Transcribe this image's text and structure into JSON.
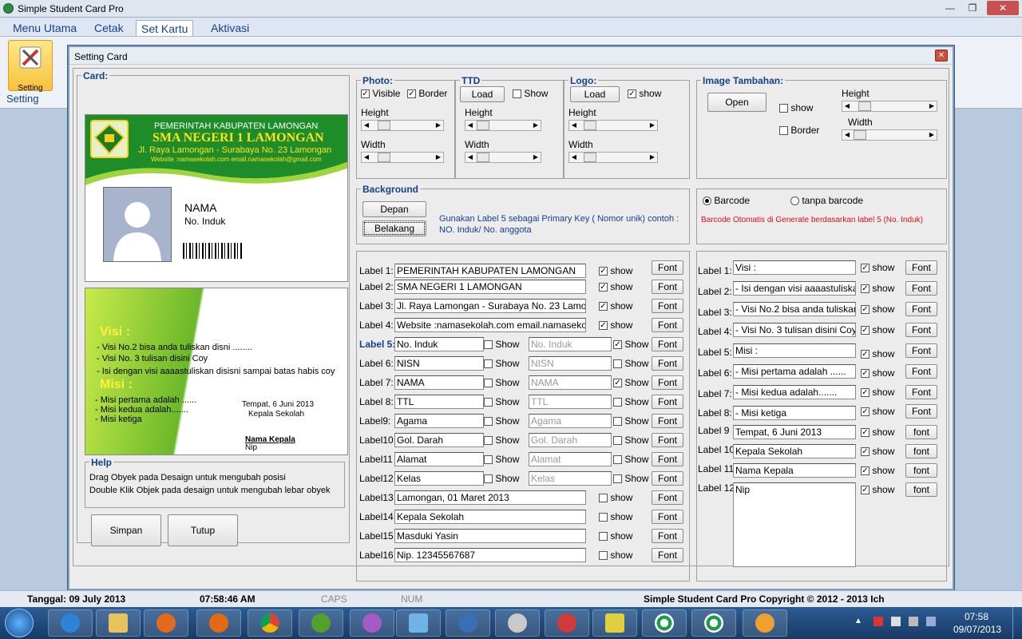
{
  "app_title": "Simple Student Card Pro",
  "menu": [
    "Menu Utama",
    "Cetak",
    "Set Kartu",
    "Aktivasi"
  ],
  "ribbon": {
    "button_label": "Setting",
    "group_label": "Setting"
  },
  "dialog": {
    "title": "Setting Card",
    "card_group": "Card:",
    "card_front": {
      "header_line1": "PEMERINTAH KABUPATEN LAMONGAN",
      "header_line2": "SMA NEGERI 1 LAMONGAN",
      "header_line3": "Jl. Raya Lamongan - Surabaya No. 23 Lamongan",
      "header_line4": "Website :namasekolah.com email.namasekolah@gmail.com",
      "name": "NAMA",
      "induk": "No. Induk"
    },
    "card_back": {
      "visi_title": "Visi :",
      "visi_items": [
        "- Visi No.2 bisa anda tuliskan disni ........",
        "- Visi No. 3 tulisan disini Coy",
        "- Isi dengan visi aaaastuliskan disisni sampai batas habis coy"
      ],
      "misi_title": "Misi :",
      "misi_items": [
        "- Misi pertama adalah ......",
        "- Misi kedua adalah.......",
        "- Misi ketiga"
      ],
      "place_date": "Tempat, 6 Juni 2013",
      "position": "Kepala Sekolah",
      "head_name": "Nama Kepala",
      "nip": "Nip"
    },
    "help": {
      "title": "Help",
      "line1": "Drag Obyek pada Desaign untuk mengubah posisi",
      "line2": "Double Klik Objek pada desaign untuk mengubah lebar obyek"
    },
    "buttons": {
      "save": "Simpan",
      "close": "Tutup"
    },
    "photo": {
      "title": "Photo:",
      "visible": "Visible",
      "border": "Border",
      "height": "Height",
      "width": "Width"
    },
    "ttd": {
      "title": "TTD",
      "load": "Load",
      "show": "Show",
      "height": "Height",
      "width": "Width"
    },
    "logo": {
      "title": "Logo:",
      "load": "Load",
      "show": "show",
      "height": "Height",
      "width": "Width"
    },
    "image_tambahan": {
      "title": "Image Tambahan:",
      "open": "Open",
      "show": "show",
      "border": "Border",
      "height": "Height",
      "width": "Width"
    },
    "background": {
      "title": "Background",
      "front": "Depan",
      "back": "Belakang",
      "hint_line1": "Gunakan Label 5 sebagai Primary Key ( Nomor unik) contoh :",
      "hint_line2": "NO. Induk/ No. anggota"
    },
    "barcode": {
      "opt1": "Barcode",
      "opt2": "tanpa barcode",
      "note": "Barcode Otomatis di Generate berdasarkan label 5 (No. Induk)"
    },
    "front_labels": [
      {
        "label": "Label 1:",
        "value": "PEMERINTAH KABUPATEN LAMONGAN",
        "show": "show",
        "checked": true,
        "font": "Font"
      },
      {
        "label": "Label 2:",
        "value": "SMA NEGERI 1 LAMONGAN",
        "show": "show",
        "checked": true,
        "font": "Font"
      },
      {
        "label": "Label 3:",
        "value": "Jl. Raya Lamongan - Surabaya No. 23 Lamongan",
        "show": "show",
        "checked": true,
        "font": "Font"
      },
      {
        "label": "Label 4:",
        "value": "Website :namasekolah.com email.namasekolah@",
        "show": "show",
        "checked": true,
        "font": "Font"
      }
    ],
    "front_pair_labels": [
      {
        "label": "Label 5:",
        "value": "No. Induk",
        "show1": "Show",
        "c1": false,
        "value2": "No. Induk",
        "show2": "Show",
        "c2": true,
        "font": "Font",
        "bold": true
      },
      {
        "label": "Label 6:",
        "value": "NISN",
        "show1": "Show",
        "c1": false,
        "value2": "NISN",
        "show2": "Show",
        "c2": false,
        "font": "Font"
      },
      {
        "label": "Label 7:",
        "value": "NAMA",
        "show1": "Show",
        "c1": false,
        "value2": "NAMA",
        "show2": "Show",
        "c2": true,
        "font": "Font"
      },
      {
        "label": "Label 8:",
        "value": "TTL",
        "show1": "Show",
        "c1": false,
        "value2": "TTL",
        "show2": "Show",
        "c2": false,
        "font": "Font"
      },
      {
        "label": "Label9:",
        "value": "Agama",
        "show1": "Show",
        "c1": false,
        "value2": "Agama",
        "show2": "Show",
        "c2": false,
        "font": "Font"
      },
      {
        "label": "Label10:",
        "value": "Gol. Darah",
        "show1": "Show",
        "c1": false,
        "value2": "Gol. Darah",
        "show2": "Show",
        "c2": false,
        "font": "Font"
      },
      {
        "label": "Label11",
        "value": "Alamat",
        "show1": "Show",
        "c1": false,
        "value2": "Alamat",
        "show2": "Show",
        "c2": false,
        "font": "Font"
      },
      {
        "label": "Label12",
        "value": "Kelas",
        "show1": "Show",
        "c1": false,
        "value2": "Kelas",
        "show2": "Show",
        "c2": false,
        "font": "Font"
      }
    ],
    "front_extra_labels": [
      {
        "label": "Label13",
        "value": "Lamongan, 01 Maret 2013",
        "show": "show",
        "checked": false,
        "font": "Font"
      },
      {
        "label": "Label14",
        "value": "Kepala Sekolah",
        "show": "show",
        "checked": false,
        "font": "Font"
      },
      {
        "label": "Label15",
        "value": "Masduki Yasin",
        "show": "show",
        "checked": false,
        "font": "Font"
      },
      {
        "label": "Label16",
        "value": "Nip. 12345567687",
        "show": "show",
        "checked": false,
        "font": "Font"
      }
    ],
    "back_labels": [
      {
        "label": "Label 1:",
        "value": "Visi :",
        "show": "show",
        "checked": true,
        "font": "Font"
      },
      {
        "label": "Label 2:",
        "value": "- Isi dengan visi aaaastuliskan",
        "show": "show",
        "checked": true,
        "font": "Font"
      },
      {
        "label": "Label 3:",
        "value": "- Visi No.2 bisa anda tuliskan",
        "show": "show",
        "checked": true,
        "font": "Font"
      },
      {
        "label": "Label 4:",
        "value": "- Visi No. 3 tulisan disini Coy",
        "show": "show",
        "checked": true,
        "font": "Font"
      },
      {
        "label": "Label 5:",
        "value": "Misi :",
        "show": "show",
        "checked": true,
        "font": "Font"
      },
      {
        "label": "Label 6:",
        "value": "- Misi pertama adalah ......",
        "show": "show",
        "checked": true,
        "font": "Font"
      },
      {
        "label": "Label 7:",
        "value": "- Misi kedua adalah.......",
        "show": "show",
        "checked": true,
        "font": "Font"
      },
      {
        "label": "Label 8:",
        "value": "- Misi ketiga",
        "show": "show",
        "checked": true,
        "font": "Font"
      },
      {
        "label": "Label 9",
        "value": "Tempat, 6 Juni 2013",
        "show": "show",
        "checked": true,
        "font": "font"
      },
      {
        "label": "Label 10",
        "value": "Kepala Sekolah",
        "show": "show",
        "checked": true,
        "font": "font"
      },
      {
        "label": "Label 11",
        "value": "Nama Kepala",
        "show": "show",
        "checked": true,
        "font": "font"
      },
      {
        "label": "Label 12",
        "value": "Nip",
        "show": "show",
        "checked": true,
        "font": "font"
      }
    ]
  },
  "status": {
    "date": "Tanggal: 09 July 2013",
    "time": "07:58:46 AM",
    "caps": "CAPS",
    "num": "NUM",
    "copyright": "Simple Student Card Pro Copyright ©  2012 - 2013 Ich"
  },
  "tray": {
    "time": "07:58",
    "date": "09/07/2013"
  }
}
